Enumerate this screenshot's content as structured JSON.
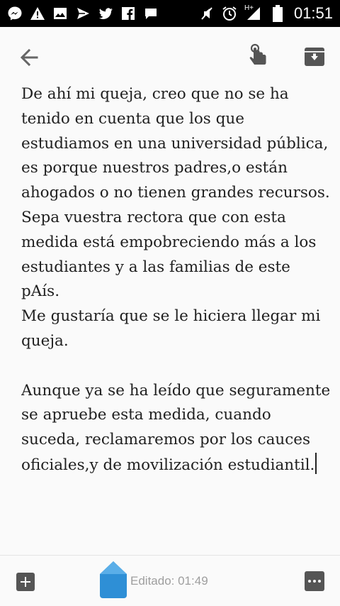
{
  "status_bar": {
    "time": "01:51",
    "network_label": "H+",
    "left_icons": [
      "messenger-icon",
      "warning-icon",
      "image-icon",
      "send-icon",
      "twitter-icon",
      "facebook-icon",
      "chat-icon"
    ],
    "right_icons": [
      "mute-icon",
      "alarm-icon",
      "signal-icon",
      "battery-icon"
    ]
  },
  "toolbar": {
    "icons": [
      "back-arrow-icon",
      "touch-icon",
      "archive-icon"
    ]
  },
  "note": {
    "text": "De ahí mi queja, creo que no se ha tenido en cuenta que los que estudiamos en una universidad pública, es porque nuestros padres,o están ahogados o no tienen grandes recursos.\nSepa vuestra rectora que con esta medida está empobreciendo más a los estudiantes y a las familias de este pAís.\nMe gustaría que se le hiciera llegar mi queja.\n\nAunque ya se ha leído que seguramente se apruebe esta medida, cuando suceda, reclamaremos por los cauces oficiales,y de movilización estudiantil."
  },
  "bottom_bar": {
    "edited_label": "Editado: 01:49",
    "icons": [
      "add-icon",
      "text-selection-handle",
      "more-icon"
    ]
  },
  "colors": {
    "status_bar_bg": "#000000",
    "background": "#fafafa",
    "icon_gray": "#555555",
    "handle_blue": "#2e8fd6",
    "text": "#1f1f1f",
    "muted_text": "#9e9e9e"
  }
}
